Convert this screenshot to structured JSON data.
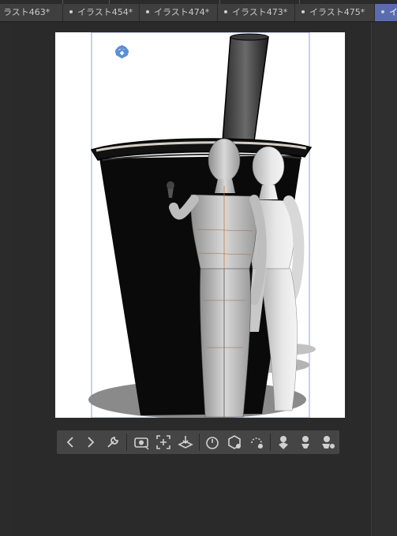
{
  "tabs": [
    {
      "label": "ラスト463*",
      "active": false
    },
    {
      "label": "イラスト454*",
      "active": false
    },
    {
      "label": "イラスト474*",
      "active": false
    },
    {
      "label": "イラスト473*",
      "active": false
    },
    {
      "label": "イラスト475*",
      "active": false
    },
    {
      "label": "イ",
      "active": true
    }
  ],
  "camera_tools": [
    "rotate-camera-icon",
    "pan-camera-icon",
    "zoom-camera-icon",
    "move-object-icon",
    "rotate-object-icon",
    "scale-object-icon",
    "rotate-xy-icon",
    "move-on-plane-icon"
  ],
  "toolbar": {
    "prev_label": "<",
    "next_label": ">",
    "buttons": [
      "prev-icon",
      "next-icon",
      "settings-wrench-icon",
      "camera-reset-icon",
      "fit-to-view-icon",
      "ground-icon",
      "timer-icon",
      "object-list-icon",
      "rotate-reset-icon",
      "pose-hand-icon",
      "pose-figure-icon",
      "pose-lock-icon"
    ]
  },
  "colors": {
    "accent_tab": "#5a6bb0",
    "canvas": "#ffffff",
    "cup": "#0a0a0a",
    "widget_blue": "#5a8fd6"
  }
}
